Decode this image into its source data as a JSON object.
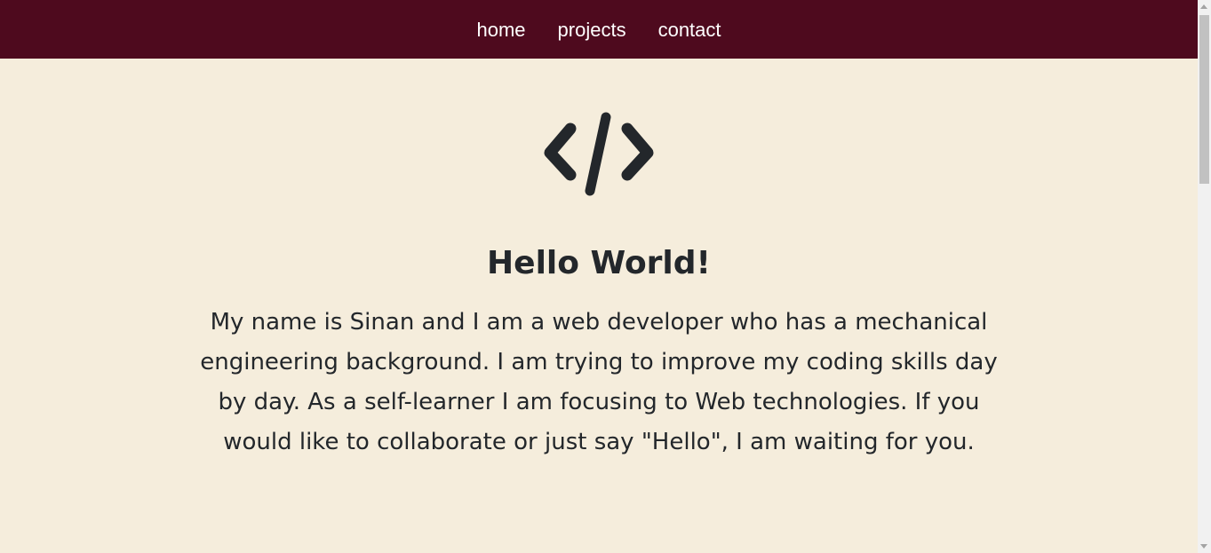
{
  "colors": {
    "navbar_background": "#4e0a1e",
    "page_background": "#f5eddc",
    "text": "#23272b",
    "nav_text": "#ffffff"
  },
  "navbar": {
    "items": [
      {
        "label": "home"
      },
      {
        "label": "projects"
      },
      {
        "label": "contact"
      }
    ]
  },
  "hero": {
    "icon": "code-icon",
    "title": "Hello World!",
    "text": "My name is Sinan and I am a web developer who has a mechanical engineering background. I am trying to improve my coding skills day by day. As a self-learner I am focusing to Web technologies. If you would like to collaborate or just say \"Hello\", I am waiting for you."
  }
}
